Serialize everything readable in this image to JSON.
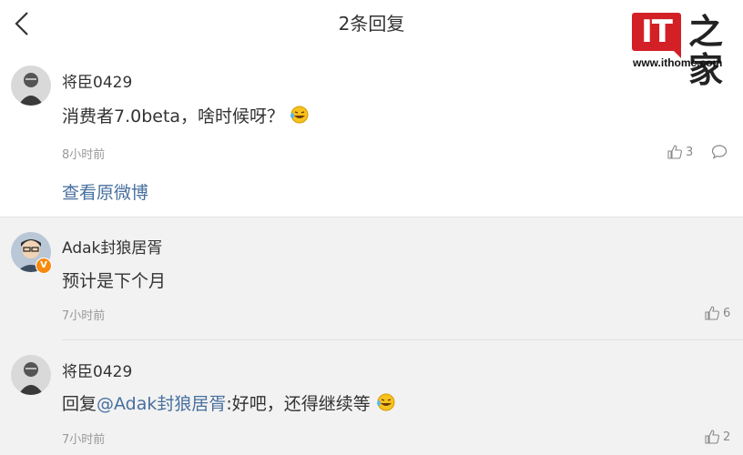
{
  "header": {
    "title": "2条回复"
  },
  "watermark": {
    "logo_letters": "IT",
    "logo_char": "之家",
    "url": "www.ithome.com"
  },
  "post": {
    "author": "将臣0429",
    "text": "消费者7.0beta，啥时候呀？",
    "time": "8小时前",
    "likes": "3",
    "view_original": "查看原微博"
  },
  "replies": [
    {
      "author": "Adak封狼居胥",
      "verified": true,
      "text": "预计是下个月",
      "time": "7小时前",
      "likes": "6"
    },
    {
      "author": "将臣0429",
      "prefix": "回复",
      "mention": "@Adak封狼居胥",
      "text": ":好吧，还得继续等",
      "time": "7小时前",
      "likes": "2"
    }
  ],
  "colors": {
    "link": "#47709e",
    "logo_red": "#d32026",
    "verified_badge": "#f68a0e"
  }
}
